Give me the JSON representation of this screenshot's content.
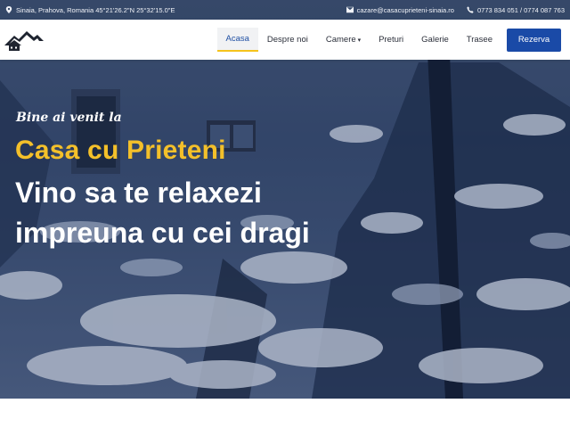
{
  "topbar": {
    "location": "Sinaia, Prahova, Romania 45°21'26.2\"N 25°32'15.0\"E",
    "email": "cazare@casacuprieteni-sinaia.ro",
    "phone": "0773 834 051 / 0774 087 763"
  },
  "navbar": {
    "items": [
      {
        "label": "Acasa",
        "active": true
      },
      {
        "label": "Despre noi"
      },
      {
        "label": "Camere",
        "dropdown": true
      },
      {
        "label": "Preturi"
      },
      {
        "label": "Galerie"
      },
      {
        "label": "Trasee"
      }
    ],
    "cta": "Rezerva"
  },
  "hero": {
    "welcome": "Bine ai venit la",
    "title": "Casa cu Prieteni",
    "line1": "Vino sa te relaxezi",
    "line2": "impreuna cu cei dragi"
  },
  "colors": {
    "primary": "#1a4aa7",
    "accent": "#f4c02a",
    "hero_overlay": "#122450"
  },
  "icons": [
    "location-pin-icon",
    "envelope-icon",
    "phone-icon",
    "mountain-house-logo",
    "chevron-down-icon"
  ]
}
